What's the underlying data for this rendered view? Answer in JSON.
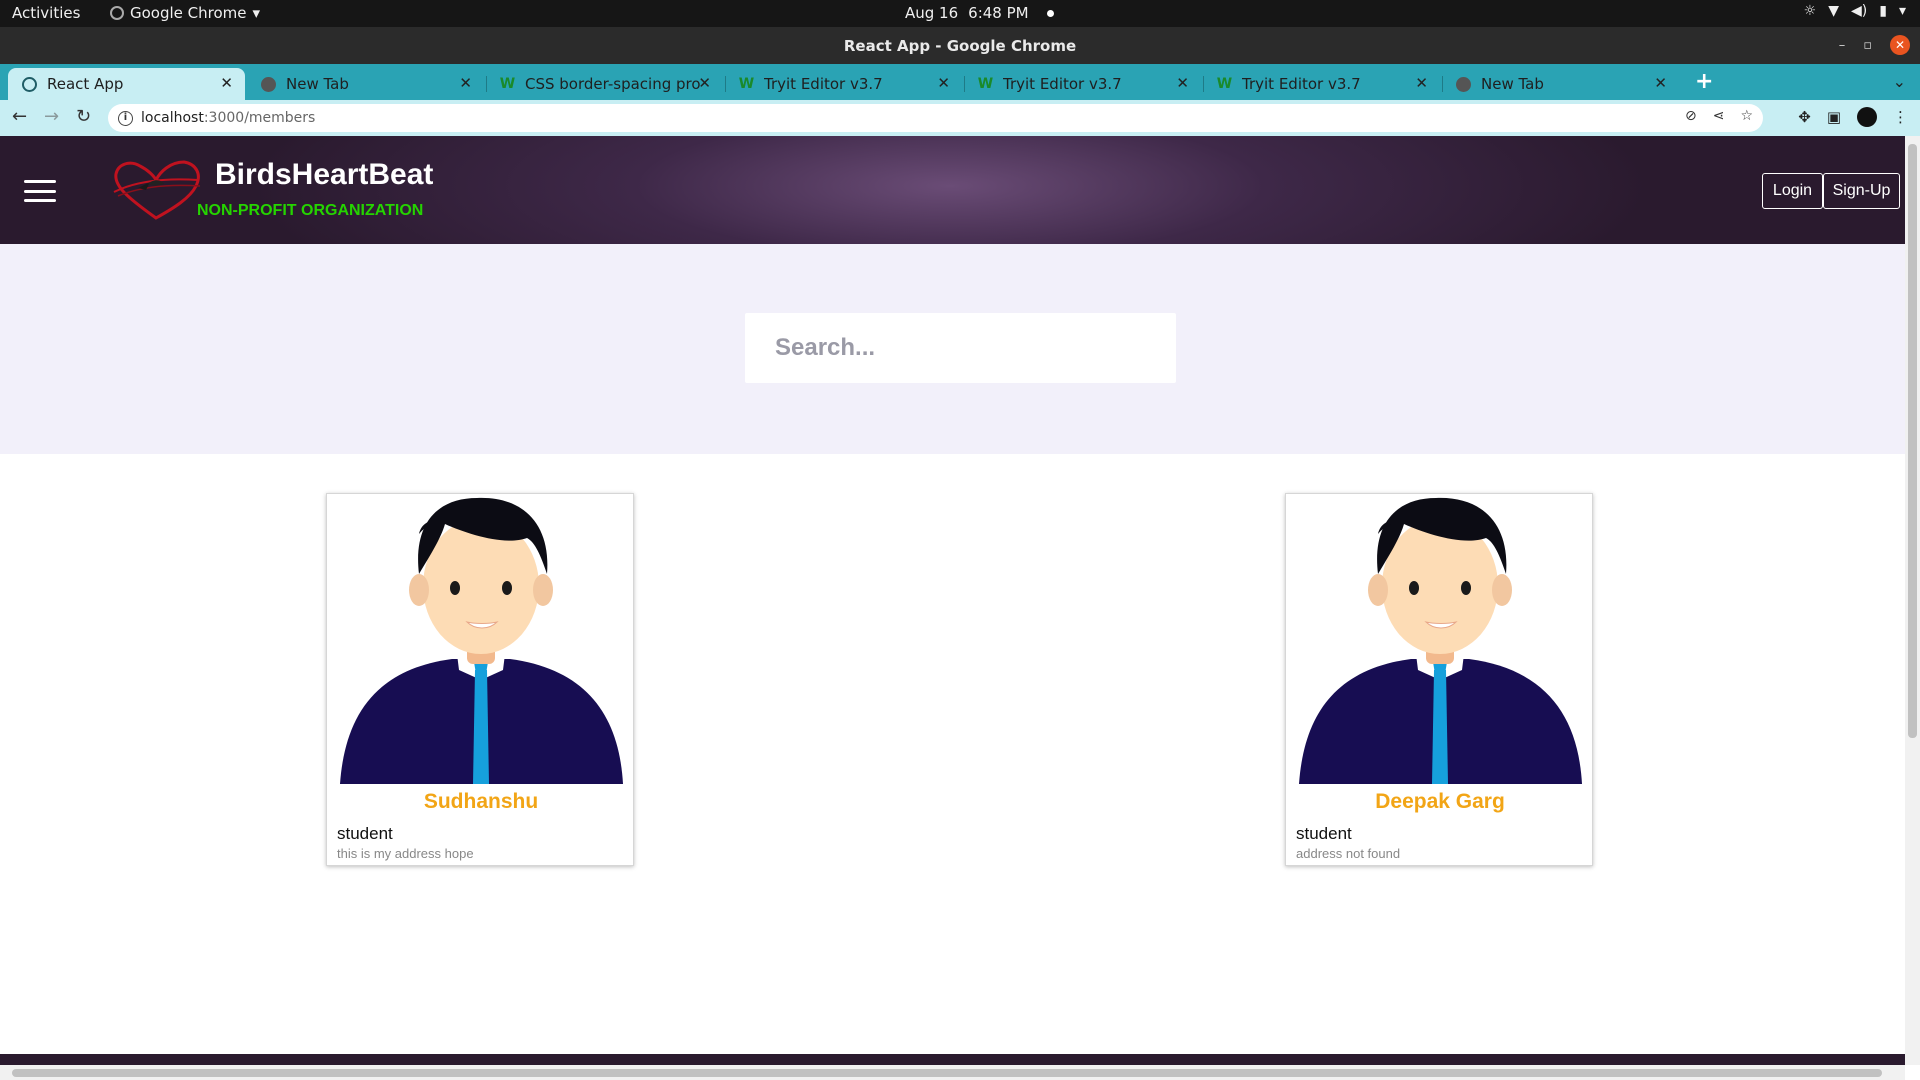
{
  "os_bar": {
    "activities": "Activities",
    "app_name": "Google Chrome",
    "date": "Aug 16",
    "time": "6:48 PM"
  },
  "window": {
    "title": "React App - Google Chrome"
  },
  "tabs": [
    {
      "label": "React App",
      "icon": "react-icon",
      "active": true
    },
    {
      "label": "New Tab",
      "icon": "chrome-icon",
      "active": false
    },
    {
      "label": "CSS border-spacing prope",
      "icon": "w-icon",
      "active": false
    },
    {
      "label": "Tryit Editor v3.7",
      "icon": "w-icon",
      "active": false
    },
    {
      "label": "Tryit Editor v3.7",
      "icon": "w-icon",
      "active": false
    },
    {
      "label": "Tryit Editor v3.7",
      "icon": "w-icon",
      "active": false
    },
    {
      "label": "New Tab",
      "icon": "chrome-icon",
      "active": false
    }
  ],
  "address_bar": {
    "host": "localhost",
    "path": ":3000/members"
  },
  "site": {
    "brand_title": "BirdsHeartBeat",
    "brand_subtitle": "NON-PROFIT ORGANIZATION",
    "login_label": "Login",
    "signup_label": "Sign-Up"
  },
  "search": {
    "placeholder": "Search..."
  },
  "members": [
    {
      "name": "Sudhanshu",
      "role": "student",
      "address": "this is my address hope"
    },
    {
      "name": "Deepak Garg",
      "role": "student",
      "address": "address not found"
    }
  ],
  "colors": {
    "tab_strip": "#2aa3b4",
    "toolbar": "#c8eef3",
    "header_dark": "#2a1a2e",
    "brand_sub": "#25d400",
    "member_name": "#f2a516",
    "search_band": "#f2f0fa"
  }
}
